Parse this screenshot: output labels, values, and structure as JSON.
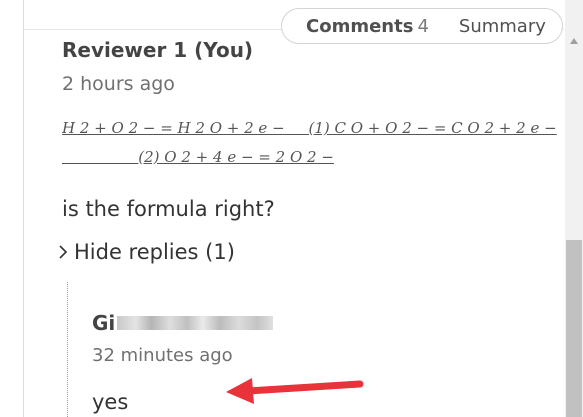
{
  "tabs": {
    "comments_label": "Comments",
    "comments_count": "4",
    "summary_label": "Summary"
  },
  "comment": {
    "author": "Reviewer 1 (You)",
    "time": "2 hours ago",
    "formula_line1": "H 2 + O 2 − = H 2 O + 2 e −     (1) C O + O 2 − = C O 2 + 2 e −",
    "formula_line2": "                (2) O 2 + 4 e − = 2 O 2 −",
    "text": "is the formula right?",
    "replies_toggle": "Hide replies (1)"
  },
  "reply": {
    "author_visible": "Gi",
    "time": "32 minutes ago",
    "text": "yes"
  },
  "colors": {
    "annotation_arrow": "#e8333a",
    "scroll_thumb": "#c1c1c1"
  },
  "icons": {
    "toggle": "chevron-right-icon",
    "scroll_up": "arrow-up-icon",
    "annotation": "red-arrow-annotation"
  }
}
